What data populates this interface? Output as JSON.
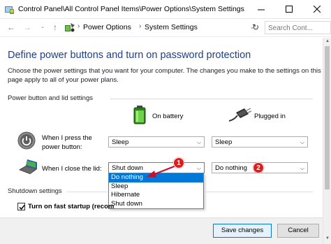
{
  "window": {
    "title": "Control Panel\\All Control Panel Items\\Power Options\\System Settings",
    "icons": {
      "app": "control-panel-icon",
      "minimize": "minimize-icon",
      "maximize": "maximize-icon",
      "close": "close-icon"
    }
  },
  "address_bar": {
    "breadcrumbs": [
      "Power Options",
      "System Settings"
    ],
    "search": {
      "placeholder": "Search Cont..."
    },
    "icons": {
      "back": "back-arrow-icon",
      "forward": "forward-arrow-icon",
      "recent": "chevron-down-icon",
      "up": "up-arrow-icon",
      "refresh": "refresh-icon"
    }
  },
  "page": {
    "heading": "Define power buttons and turn on password protection",
    "description": "Choose the power settings that you want for your computer. The changes you make to the settings on this page apply to all of your power plans.",
    "section_power": "Power button and lid settings",
    "columns": {
      "battery": {
        "label": "On battery",
        "icon": "battery-icon"
      },
      "plugged": {
        "label": "Plugged in",
        "icon": "power-plug-icon"
      }
    },
    "rows": {
      "power_button": {
        "label": "When I press the power button:",
        "icon": "power-button-icon",
        "battery_value": "Sleep",
        "plugged_value": "Sleep"
      },
      "lid": {
        "label": "When I close the lid:",
        "icon": "laptop-lid-icon",
        "battery_value": "Shut down",
        "plugged_value": "Do nothing"
      }
    },
    "dropdown_options": [
      "Do nothing",
      "Sleep",
      "Hibernate",
      "Shut down"
    ],
    "dropdown_selected": "Do nothing",
    "badges": [
      "1",
      "2"
    ],
    "section_shutdown": "Shutdown settings",
    "fast_startup": {
      "label": "Turn on fast startup (recom",
      "checked": true
    }
  },
  "footer": {
    "save": "Save changes",
    "cancel": "Cancel"
  },
  "colors": {
    "heading": "#1e3f8a",
    "selection": "#0078d7",
    "badge": "#e01b1b",
    "arrow": "#c8102e"
  }
}
